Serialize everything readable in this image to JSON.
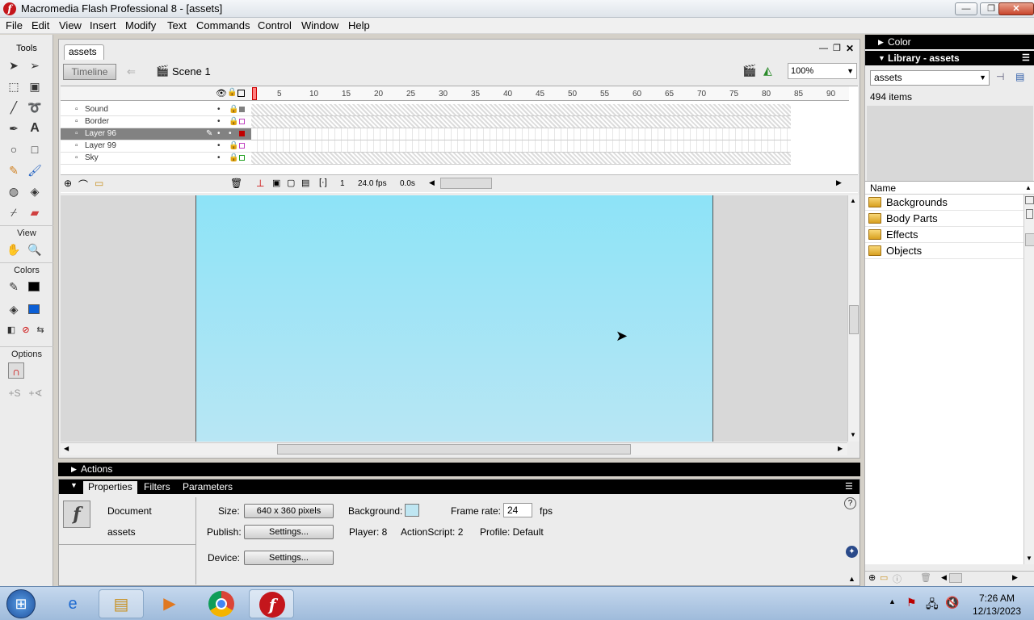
{
  "window": {
    "title": "Macromedia Flash Professional 8 - [assets]",
    "app_icon": "flash-icon",
    "min": "—",
    "max": "❐",
    "close": "✕"
  },
  "menubar": [
    "File",
    "Edit",
    "View",
    "Insert",
    "Modify",
    "Text",
    "Commands",
    "Control",
    "Window",
    "Help"
  ],
  "tools": {
    "header": "Tools",
    "view_header": "View",
    "colors_header": "Colors",
    "options_header": "Options",
    "stroke_color": "#000000",
    "fill_color": "#0b5fd6"
  },
  "document": {
    "tab": "assets",
    "timeline_button": "Timeline",
    "scene": "Scene 1",
    "zoom": "100%"
  },
  "timeline": {
    "layers": [
      {
        "name": "Sound",
        "color": "#808080"
      },
      {
        "name": "Border",
        "color": "#c040c0"
      },
      {
        "name": "Layer 96",
        "color": "#c00000",
        "selected": true
      },
      {
        "name": "Layer 99",
        "color": "#c040c0"
      },
      {
        "name": "Sky",
        "color": "#20a020"
      }
    ],
    "ruler_ticks": [
      "5",
      "10",
      "15",
      "20",
      "25",
      "30",
      "35",
      "40",
      "45",
      "50",
      "55",
      "60",
      "65",
      "70",
      "75",
      "80",
      "85",
      "90"
    ],
    "current_frame": "1",
    "fps": "24.0 fps",
    "elapsed": "0.0s"
  },
  "stage": {
    "background": "#8de3f7"
  },
  "actions_label": "Actions",
  "properties": {
    "tabs": [
      "Properties",
      "Filters",
      "Parameters"
    ],
    "doc_type": "Document",
    "doc_name": "assets",
    "size_label": "Size:",
    "size_value": "640 x 360 pixels",
    "background_label": "Background:",
    "framerate_label": "Frame rate:",
    "framerate_value": "24",
    "fps_unit": "fps",
    "publish_label": "Publish:",
    "settings_button": "Settings...",
    "player": "Player: 8",
    "actionscript": "ActionScript: 2",
    "profile": "Profile: Default",
    "device_label": "Device:",
    "device_settings": "Settings..."
  },
  "right_panel": {
    "color_header": "Color",
    "library_header": "Library - assets",
    "library_select": "assets",
    "item_count": "494 items",
    "name_column": "Name",
    "items": [
      "Backgrounds",
      "Body Parts",
      "Effects",
      "Objects"
    ]
  },
  "taskbar": {
    "apps": [
      "start-orb",
      "ie-icon",
      "explorer-icon",
      "media-player-icon",
      "chrome-icon",
      "flash-icon"
    ],
    "time": "7:26 AM",
    "date": "12/13/2023"
  }
}
